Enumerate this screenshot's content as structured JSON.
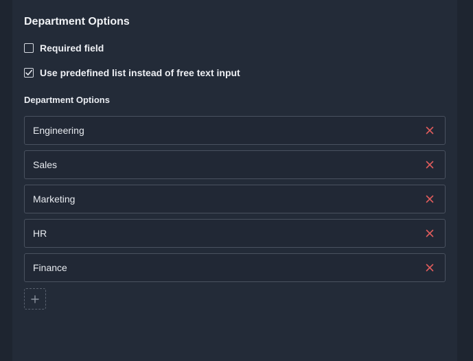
{
  "section": {
    "title": "Department Options"
  },
  "checkboxes": [
    {
      "label": "Required field",
      "checked": false
    },
    {
      "label": "Use predefined list instead of free text input",
      "checked": true
    }
  ],
  "options_section": {
    "title": "Department Options"
  },
  "options": [
    {
      "value": "Engineering",
      "remove_icon": "close-icon"
    },
    {
      "value": "Sales",
      "remove_icon": "close-icon"
    },
    {
      "value": "Marketing",
      "remove_icon": "close-icon"
    },
    {
      "value": "HR",
      "remove_icon": "close-icon"
    },
    {
      "value": "Finance",
      "remove_icon": "close-icon"
    }
  ],
  "add_button": {
    "icon": "plus-icon"
  },
  "colors": {
    "remove": "#e05c5c",
    "accent_text": "#eef0f4"
  }
}
